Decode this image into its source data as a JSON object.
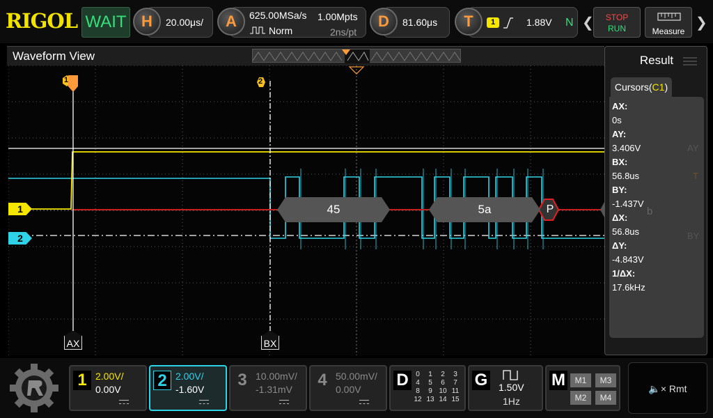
{
  "topbar": {
    "brand": "RIGOL",
    "status": "WAIT",
    "horizontal": {
      "icon": "H",
      "timebase": "20.00μs/"
    },
    "acquire": {
      "icon": "A",
      "sample_rate": "625.00MSa/s",
      "memory_depth": "1.00Mpts",
      "mode": "Norm",
      "resolution": "2ns/pt"
    },
    "delay": {
      "icon": "D",
      "value": "81.60μs"
    },
    "trigger": {
      "icon": "T",
      "source": "1",
      "level": "1.88V",
      "mode": "N"
    },
    "stop_label": "STOP",
    "run_label": "RUN",
    "measure_label": "Measure"
  },
  "waveform_view": {
    "title": "Waveform View",
    "trigger_marker": "1",
    "cursor2_marker": "2",
    "ch1_marker": "1",
    "ch2_marker": "2",
    "cursor_ax": "AX",
    "cursor_bx": "BX",
    "decode": [
      "45",
      "5a"
    ],
    "stop_marker": "P",
    "ghost_labels": {
      "ay": "AY",
      "by": "BY",
      "t": "T",
      "b": "b"
    }
  },
  "result": {
    "title": "Result",
    "tab_prefix": "Cursors(",
    "tab_channel": "C1",
    "tab_suffix": ")",
    "rows": [
      {
        "label": "AX:",
        "value": "0s"
      },
      {
        "label": "AY:",
        "value": "3.406V"
      },
      {
        "label": "BX:",
        "value": "56.8us"
      },
      {
        "label": "BY:",
        "value": "-1.437V"
      },
      {
        "label": "ΔX:",
        "value": "56.8us"
      },
      {
        "label": "ΔY:",
        "value": "-4.843V"
      },
      {
        "label": "1/ΔX:",
        "value": "17.6kHz"
      }
    ]
  },
  "channels": [
    {
      "num": "1",
      "scale": "2.00V/",
      "offset": "0.00V"
    },
    {
      "num": "2",
      "scale": "2.00V/",
      "offset": "-1.60V"
    },
    {
      "num": "3",
      "scale": "10.00mV/",
      "offset": "-1.31mV"
    },
    {
      "num": "4",
      "scale": "50.00mV/",
      "offset": "0.00V"
    }
  ],
  "digital": {
    "label": "D",
    "rows": [
      [
        "0",
        "1",
        "2",
        "3"
      ],
      [
        "4",
        "5",
        "6",
        "7"
      ],
      [
        "8",
        "9",
        "10",
        "11"
      ],
      [
        "12",
        "13",
        "14",
        "15"
      ]
    ]
  },
  "generator": {
    "label": "G",
    "amplitude": "1.50V",
    "frequency": "1Hz"
  },
  "math": {
    "label": "M",
    "buttons": [
      "M1",
      "M3",
      "M2",
      "M4"
    ]
  },
  "remote": {
    "label": "Rmt"
  },
  "colors": {
    "ch1": "#f5e600",
    "ch2": "#2fd3e8",
    "decode_line": "#c81e1e",
    "orange": "#ff9a3a",
    "accent_green": "#35e07a"
  }
}
